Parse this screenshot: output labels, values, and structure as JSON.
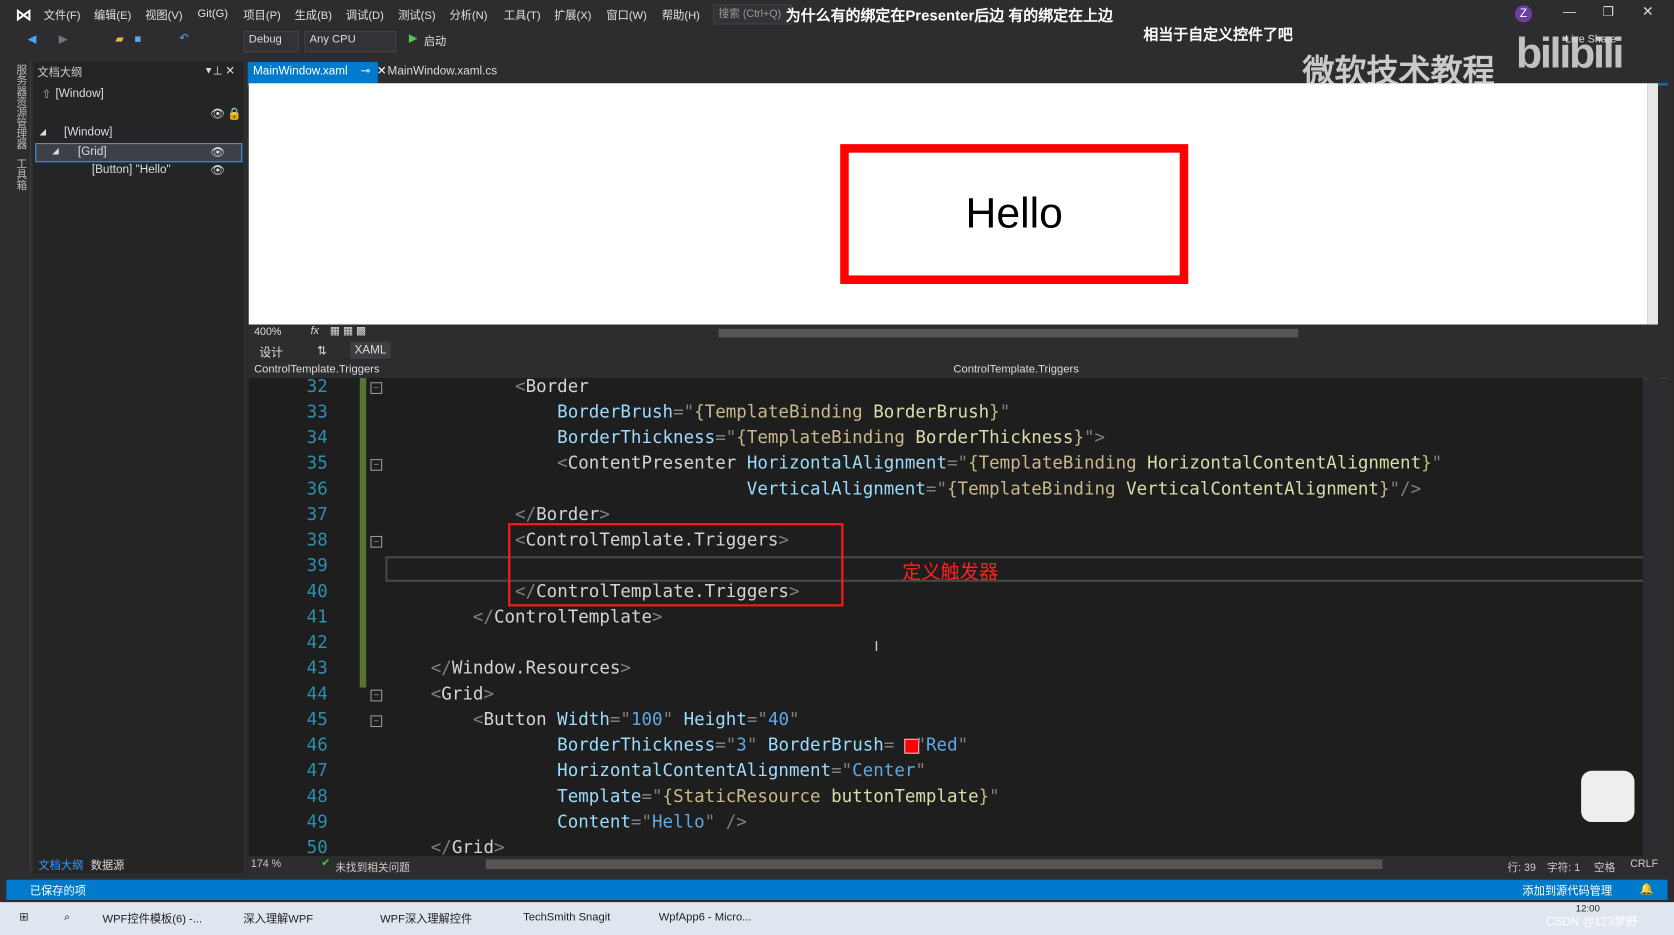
{
  "app": {
    "menu": [
      "文件(F)",
      "编辑(E)",
      "视图(V)",
      "Git(G)",
      "项目(P)",
      "生成(B)",
      "调试(D)",
      "测试(S)",
      "分析(N)",
      "工具(T)",
      "扩展(X)",
      "窗口(W)",
      "帮助(H)"
    ],
    "search_placeholder": "搜索 (Ctrl+Q)",
    "user_initial": "Z",
    "live_share": "Live Share"
  },
  "overlay": {
    "question": "为什么有的绑定在Presenter后边 有的绑定在上边",
    "comment": "相当于自定义控件了吧",
    "watermark": "微软技术教程",
    "logo": "bilibili"
  },
  "toolbar": {
    "config": "Debug",
    "platform": "Any CPU",
    "start": "启动"
  },
  "left_strip": [
    "服务器资源管理器",
    "工具箱"
  ],
  "outline": {
    "title": "文档大纲",
    "root": "[Window]",
    "items": [
      "[Window]",
      "[Grid]",
      "[Button] \"Hello\""
    ],
    "tabs": [
      "文档大纲",
      "数据源"
    ]
  },
  "tabs": [
    {
      "label": "MainWindow.xaml",
      "active": true
    },
    {
      "label": "MainWindow.xaml.cs",
      "active": false
    }
  ],
  "designer": {
    "button_content": "Hello",
    "button_border_color": "#ff0000",
    "zoom": "400%"
  },
  "split": {
    "design": "设计",
    "xaml": "XAML"
  },
  "nav": {
    "left": "ControlTemplate.Triggers",
    "right": "ControlTemplate.Triggers"
  },
  "editor": {
    "lines": [
      {
        "n": "32",
        "tokens": [
          [
            "s",
            "            "
          ],
          [
            "p",
            "<"
          ],
          [
            "t",
            "Border"
          ]
        ]
      },
      {
        "n": "33",
        "tokens": [
          [
            "s",
            "                "
          ],
          [
            "a",
            "BorderBrush"
          ],
          [
            "p",
            "=\""
          ],
          [
            "m",
            "{TemplateBinding "
          ],
          [
            "g",
            "BorderBrush"
          ],
          [
            "m",
            "}"
          ],
          [
            "p",
            "\""
          ]
        ]
      },
      {
        "n": "34",
        "tokens": [
          [
            "s",
            "                "
          ],
          [
            "a",
            "BorderThickness"
          ],
          [
            "p",
            "=\""
          ],
          [
            "m",
            "{TemplateBinding "
          ],
          [
            "g",
            "BorderThickness"
          ],
          [
            "m",
            "}"
          ],
          [
            "p",
            "\">"
          ]
        ]
      },
      {
        "n": "35",
        "tokens": [
          [
            "s",
            "                "
          ],
          [
            "p",
            "<"
          ],
          [
            "t",
            "ContentPresenter "
          ],
          [
            "a",
            "HorizontalAlignment"
          ],
          [
            "p",
            "=\""
          ],
          [
            "m",
            "{TemplateBinding "
          ],
          [
            "g",
            "HorizontalContentAlignment"
          ],
          [
            "m",
            "}"
          ],
          [
            "p",
            "\""
          ]
        ]
      },
      {
        "n": "36",
        "tokens": [
          [
            "s",
            "                                  "
          ],
          [
            "a",
            "VerticalAlignment"
          ],
          [
            "p",
            "=\""
          ],
          [
            "m",
            "{TemplateBinding "
          ],
          [
            "g",
            "VerticalContentAlignment"
          ],
          [
            "m",
            "}"
          ],
          [
            "p",
            "\"/>"
          ]
        ]
      },
      {
        "n": "37",
        "tokens": [
          [
            "s",
            "            "
          ],
          [
            "p",
            "</"
          ],
          [
            "t",
            "Border"
          ],
          [
            "p",
            ">"
          ]
        ]
      },
      {
        "n": "38",
        "tokens": [
          [
            "s",
            "            "
          ],
          [
            "p",
            "<"
          ],
          [
            "t",
            "ControlTemplate.Triggers"
          ],
          [
            "p",
            ">"
          ]
        ]
      },
      {
        "n": "39",
        "tokens": []
      },
      {
        "n": "40",
        "tokens": [
          [
            "s",
            "            "
          ],
          [
            "p",
            "</"
          ],
          [
            "t",
            "ControlTemplate.Triggers"
          ],
          [
            "p",
            ">"
          ]
        ]
      },
      {
        "n": "41",
        "tokens": [
          [
            "s",
            "        "
          ],
          [
            "p",
            "</"
          ],
          [
            "t",
            "ControlTemplate"
          ],
          [
            "p",
            ">"
          ]
        ]
      },
      {
        "n": "42",
        "tokens": []
      },
      {
        "n": "43",
        "tokens": [
          [
            "s",
            "    "
          ],
          [
            "p",
            "</"
          ],
          [
            "t",
            "Window.Resources"
          ],
          [
            "p",
            ">"
          ]
        ]
      },
      {
        "n": "44",
        "tokens": [
          [
            "s",
            "    "
          ],
          [
            "p",
            "<"
          ],
          [
            "t",
            "Grid"
          ],
          [
            "p",
            ">"
          ]
        ]
      },
      {
        "n": "45",
        "tokens": [
          [
            "s",
            "        "
          ],
          [
            "p",
            "<"
          ],
          [
            "t",
            "Button "
          ],
          [
            "a",
            "Width"
          ],
          [
            "p",
            "=\""
          ],
          [
            "v",
            "100"
          ],
          [
            "p",
            "\" "
          ],
          [
            "a",
            "Height"
          ],
          [
            "p",
            "=\""
          ],
          [
            "v",
            "40"
          ],
          [
            "p",
            "\""
          ]
        ]
      },
      {
        "n": "46",
        "tokens": [
          [
            "s",
            "                "
          ],
          [
            "a",
            "BorderThickness"
          ],
          [
            "p",
            "=\""
          ],
          [
            "v",
            "3"
          ],
          [
            "p",
            "\" "
          ],
          [
            "a",
            "BorderBrush"
          ],
          [
            "p",
            "="
          ],
          [
            "s",
            "  "
          ],
          [
            "p",
            "\""
          ],
          [
            "v",
            "Red"
          ],
          [
            "p",
            "\""
          ]
        ]
      },
      {
        "n": "47",
        "tokens": [
          [
            "s",
            "                "
          ],
          [
            "a",
            "HorizontalContentAlignment"
          ],
          [
            "p",
            "=\""
          ],
          [
            "v",
            "Center"
          ],
          [
            "p",
            "\""
          ]
        ]
      },
      {
        "n": "48",
        "tokens": [
          [
            "s",
            "                "
          ],
          [
            "a",
            "Template"
          ],
          [
            "p",
            "=\""
          ],
          [
            "m",
            "{StaticResource "
          ],
          [
            "g",
            "buttonTemplate"
          ],
          [
            "m",
            "}"
          ],
          [
            "p",
            "\""
          ]
        ]
      },
      {
        "n": "49",
        "tokens": [
          [
            "s",
            "                "
          ],
          [
            "a",
            "Content"
          ],
          [
            "p",
            "=\""
          ],
          [
            "v",
            "Hello"
          ],
          [
            "p",
            "\" />"
          ]
        ]
      },
      {
        "n": "50",
        "tokens": [
          [
            "s",
            "    "
          ],
          [
            "p",
            "</"
          ],
          [
            "t",
            "Grid"
          ],
          [
            "p",
            ">"
          ]
        ]
      }
    ],
    "annotation": "定义触发器",
    "zoom": "174 %",
    "issues": "未找到相关问题",
    "row": "行: 39",
    "col": "字符: 1",
    "spaces": "空格",
    "eol": "CRLF"
  },
  "status": {
    "saved": "已保存的项",
    "source_control": "添加到源代码管理"
  },
  "taskbar": {
    "items": [
      "WPF控件模板(6) -...",
      "深入理解WPF",
      "WPF深入理解控件",
      "TechSmith Snagit",
      "WpfApp6 - Micro..."
    ],
    "time": "12:00",
    "credit": "CSDN @123梦野"
  },
  "colors": {
    "accent": "#007acc",
    "annotation": "#ff2020"
  }
}
